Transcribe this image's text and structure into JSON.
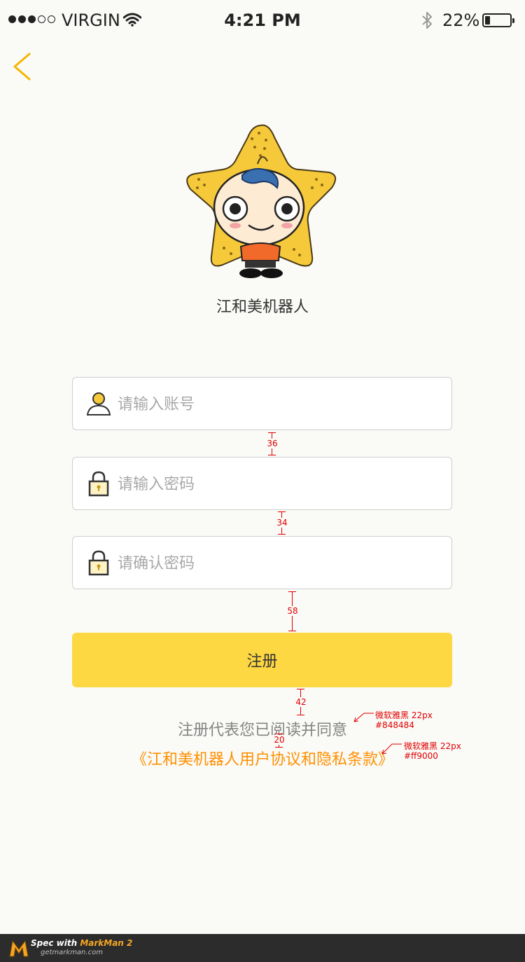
{
  "status_bar": {
    "carrier": "VIRGIN",
    "time": "4:21 PM",
    "battery": "22%",
    "battery_level": 0.22,
    "signal_bars_filled": 3,
    "signal_bars_total": 5
  },
  "header": {
    "back_icon": "chevron-left-icon",
    "accent_color": "#f5b700"
  },
  "brand": {
    "app_name": "江和美机器人",
    "mascot_icon": "star-mascot-icon"
  },
  "form": {
    "account_placeholder": "请输入账号",
    "password_placeholder": "请输入密码",
    "confirm_placeholder": "请确认密码",
    "account_value": "",
    "password_value": "",
    "confirm_value": ""
  },
  "actions": {
    "register_label": "注册",
    "register_color": "#fed843"
  },
  "agreement": {
    "text": "注册代表您已阅读并同意",
    "text_color": "#848484",
    "link": "《江和美机器人用户协议和隐私条款》",
    "link_color": "#ff9000"
  },
  "spec_annotations": {
    "gap_1": "36",
    "gap_2": "34",
    "gap_3": "58",
    "gap_4": "42",
    "gap_5": "20",
    "note_1_font": "微软雅黑 22px",
    "note_1_color": "#848484",
    "note_2_font": "微软雅黑 22px",
    "note_2_color": "#ff9000"
  },
  "footer": {
    "prefix": "Spec with ",
    "brand": "MarkMan 2",
    "url": "getmarkman.com"
  }
}
